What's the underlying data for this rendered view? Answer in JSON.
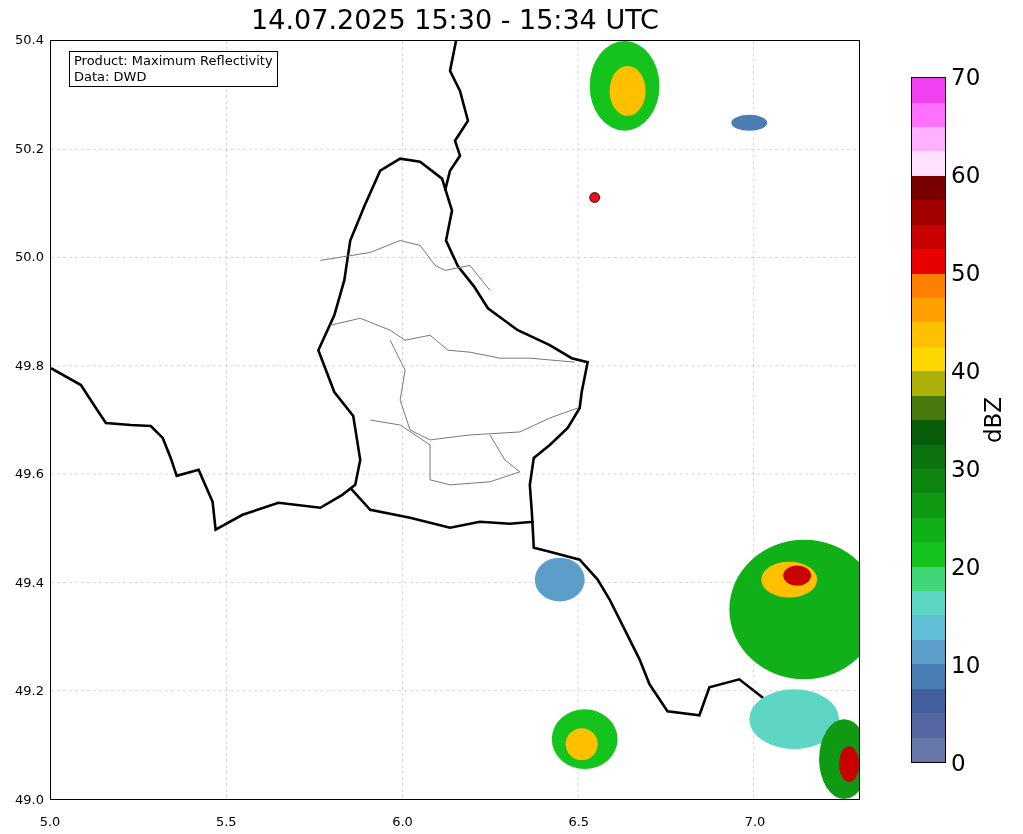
{
  "title": "14.07.2025 15:30 - 15:34 UTC",
  "legend": [
    "Product: Maximum Reflectivity",
    "Data: DWD"
  ],
  "y_ticks": [
    "50.4",
    "50.2",
    "50.0",
    "49.8",
    "49.6",
    "49.4",
    "49.2",
    "49.0"
  ],
  "x_ticks": [
    "5.0",
    "5.5",
    "6.0",
    "6.5",
    "7.0"
  ],
  "colorbar": {
    "label": "dBZ",
    "ticks": [
      "70",
      "60",
      "50",
      "40",
      "30",
      "20",
      "10",
      "0"
    ],
    "bands": [
      {
        "color": "#6677a8"
      },
      {
        "color": "#5566a2"
      },
      {
        "color": "#44609f"
      },
      {
        "color": "#4a7db4"
      },
      {
        "color": "#5b9ec9"
      },
      {
        "color": "#62bfd8"
      },
      {
        "color": "#5dd6c4"
      },
      {
        "color": "#3fd675"
      },
      {
        "color": "#14c41c"
      },
      {
        "color": "#10b018"
      },
      {
        "color": "#0f9a14"
      },
      {
        "color": "#0d8610"
      },
      {
        "color": "#0b720e"
      },
      {
        "color": "#095e0b"
      },
      {
        "color": "#4a7a0e"
      },
      {
        "color": "#aeb00a"
      },
      {
        "color": "#ffd700"
      },
      {
        "color": "#ffc000"
      },
      {
        "color": "#ffa000"
      },
      {
        "color": "#ff8000"
      },
      {
        "color": "#e80000"
      },
      {
        "color": "#c80000"
      },
      {
        "color": "#a00000"
      },
      {
        "color": "#780000"
      },
      {
        "color": "#ffe0ff"
      },
      {
        "color": "#ffb0ff"
      },
      {
        "color": "#ff70ff"
      },
      {
        "color": "#f040f0"
      }
    ]
  }
}
